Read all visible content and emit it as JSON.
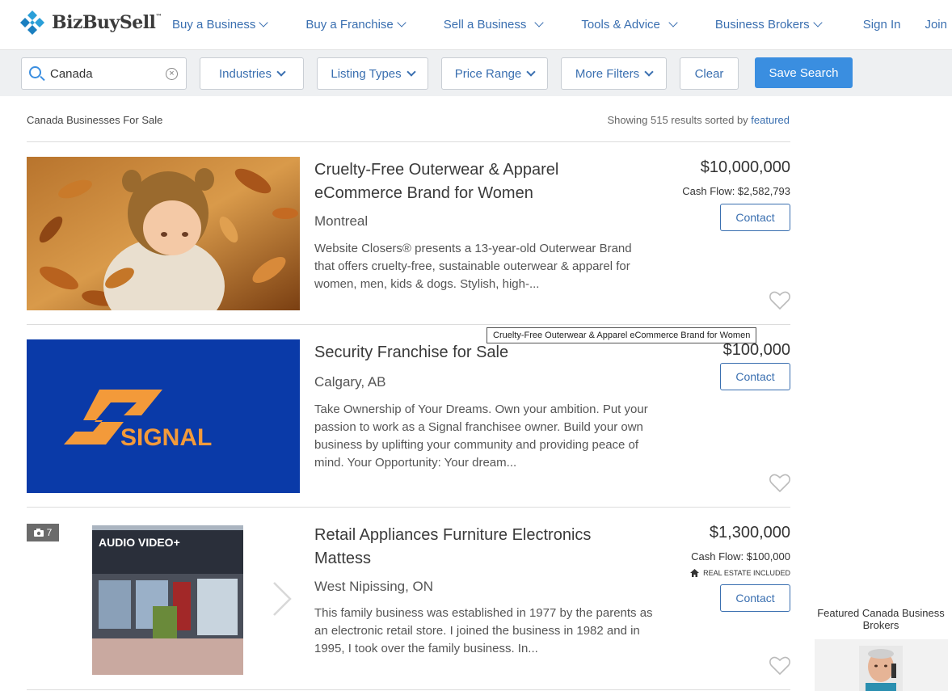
{
  "header": {
    "logo_text": "BizBuySell",
    "logo_tm": "™",
    "nav": [
      {
        "label": "Buy a Business"
      },
      {
        "label": "Buy a Franchise"
      },
      {
        "label": "Sell a Business"
      },
      {
        "label": "Tools & Advice"
      },
      {
        "label": "Business Brokers"
      }
    ],
    "sign_in": "Sign In",
    "join": "Join"
  },
  "filters": {
    "search_value": "Canada",
    "industries": "Industries",
    "listing_types": "Listing Types",
    "price_range": "Price Range",
    "more_filters": "More Filters",
    "clear": "Clear",
    "save_search": "Save Search"
  },
  "results": {
    "title": "Canada Businesses For Sale",
    "count_prefix": "Showing 515 results sorted by ",
    "sort": "featured"
  },
  "listings": [
    {
      "title": "Cruelty-Free Outerwear & Apparel eCommerce Brand for Women",
      "location": "Montreal",
      "description": "Website Closers® presents a 13-year-old Outerwear Brand that offers cruelty-free, sustainable outerwear & apparel for women, men, kids & dogs. Stylish, high-...",
      "price": "$10,000,000",
      "cash_flow": "Cash Flow: $2,582,793",
      "contact": "Contact"
    },
    {
      "title": "Security Franchise for Sale",
      "location": "Calgary, AB",
      "description": "Take Ownership of Your Dreams. Own your ambition. Put your passion to work as a Signal franchisee owner. Build your own business by uplifting your community and providing peace of mind. Your Opportunity: Your dream...",
      "price": "$100,000",
      "contact": "Contact",
      "logo_text": "SIGNAL"
    },
    {
      "title": "Retail Appliances Furniture Electronics Mattess",
      "location": "West Nipissing, ON",
      "description": "This family business was established in 1977 by the parents as an electronic retail store. I joined the business in 1982 and in 1995, I took over the family business. In...",
      "price": "$1,300,000",
      "cash_flow": "Cash Flow: $100,000",
      "real_estate": "REAL ESTATE INCLUDED",
      "photo_count": "7",
      "contact": "Contact",
      "store_sign": "AUDIO VIDEO+"
    }
  ],
  "tooltip": "Cruelty-Free Outerwear & Apparel eCommerce Brand for Women",
  "sidebar": {
    "title": "Featured Canada Business Brokers"
  },
  "colors": {
    "link_blue": "#3a6fb0",
    "primary_blue": "#3a8ee0",
    "signal_blue": "#0a3aa8",
    "signal_orange": "#f39a3a"
  }
}
